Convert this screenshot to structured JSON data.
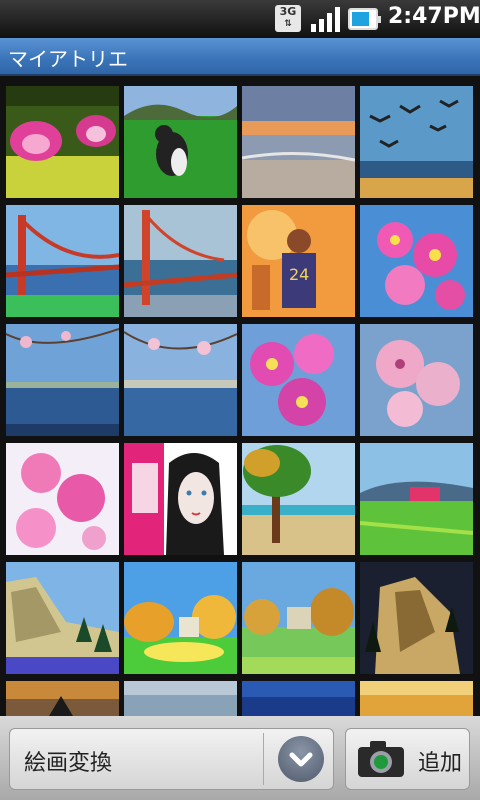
{
  "status_bar": {
    "network": "3G",
    "time": "2:47PM",
    "icons": [
      "network-3g-icon",
      "signal-icon",
      "battery-icon"
    ]
  },
  "title_bar": {
    "title": "マイアトリエ"
  },
  "gallery": {
    "columns": 4,
    "items": [
      {
        "subject": "lotus flowers"
      },
      {
        "subject": "dog on grass"
      },
      {
        "subject": "sunset beach"
      },
      {
        "subject": "birds over water"
      },
      {
        "subject": "golden gate bridge"
      },
      {
        "subject": "golden gate bridge"
      },
      {
        "subject": "basketball player"
      },
      {
        "subject": "cherry blossoms"
      },
      {
        "subject": "cherry blossoms over harbor"
      },
      {
        "subject": "cherry blossoms over harbor"
      },
      {
        "subject": "cherry blossoms"
      },
      {
        "subject": "cherry blossoms"
      },
      {
        "subject": "cherry blossoms"
      },
      {
        "subject": "woman portrait"
      },
      {
        "subject": "tree by beach"
      },
      {
        "subject": "green meadow"
      },
      {
        "subject": "el capitan"
      },
      {
        "subject": "autumn landscape"
      },
      {
        "subject": "autumn landscape"
      },
      {
        "subject": "el capitan dark"
      },
      {
        "subject": "partial"
      },
      {
        "subject": "partial"
      },
      {
        "subject": "partial"
      },
      {
        "subject": "partial"
      }
    ]
  },
  "bottom_bar": {
    "mode_label": "絵画変換",
    "add_label": "追加",
    "icons": [
      "chevron-down-icon",
      "camera-icon"
    ]
  }
}
